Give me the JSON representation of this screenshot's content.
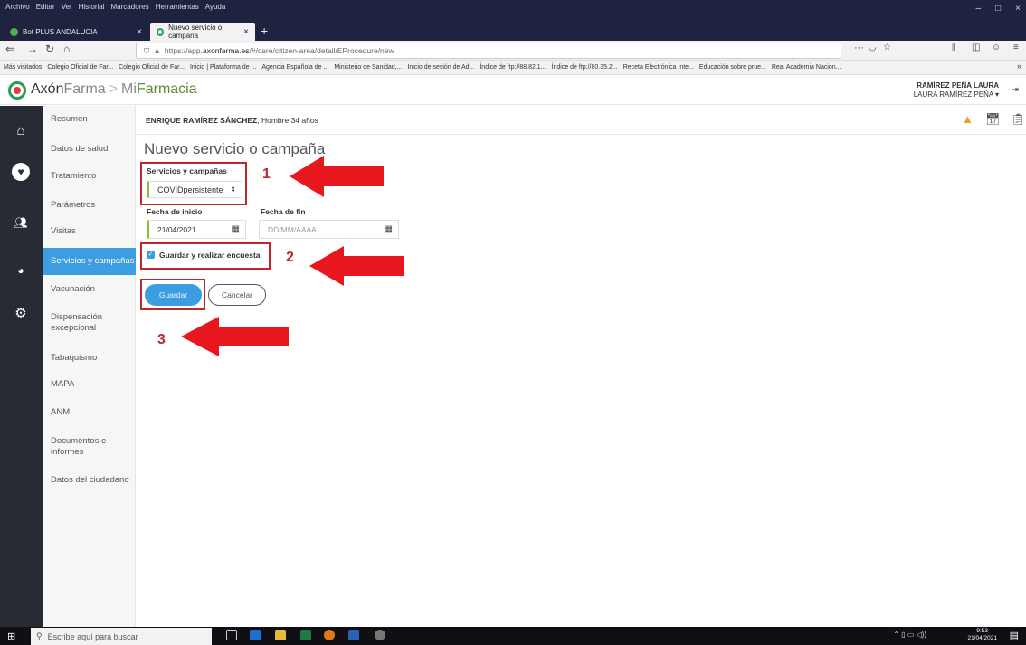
{
  "browser": {
    "menu": [
      "Archivo",
      "Editar",
      "Ver",
      "Historial",
      "Marcadores",
      "Herramientas",
      "Ayuda"
    ],
    "tabs": [
      {
        "label": "Bot PLUS ANDALUCIA",
        "close": "×"
      },
      {
        "label": "Nuevo servicio o campaña",
        "close": "×"
      }
    ],
    "new_tab": "+",
    "window_controls": {
      "minimize": "–",
      "maximize": "□",
      "close": "×"
    },
    "url": {
      "prefix": "https://app.",
      "domain": "axonfarma.es",
      "path": "/#/care/citizen-area/detail/EProcedure/new"
    },
    "url_more": "···",
    "bookmarks": [
      "Más visitados",
      "Colegio Oficial de Far...",
      "Colegio Oficial de Far...",
      "Inicio | Plataforma de ...",
      "Agencia Española de ...",
      "Ministerio de Sanidad,...",
      "Inicio de sesión de Ad...",
      "Índice de ftp://88.82.1...",
      "Índice de ftp://80.35.2...",
      "Receta Electrónica Inte...",
      "Educación sobre prue...",
      "Real Academia Nacion..."
    ],
    "bookmarks_more": "»"
  },
  "app": {
    "brand_axon": "Axón",
    "brand_farma": "Farma",
    "brand_sep": ">",
    "brand_mi": "Mi",
    "brand_farmacia": "Farmacia",
    "user_name": "RAMÍREZ PEÑA LAURA",
    "user_sub": "LAURA RAMÍREZ PEÑA ▾"
  },
  "sidebar": {
    "items": [
      "Resumen",
      "Datos de salud",
      "Tratamiento",
      "Parámetros",
      "Visitas",
      "Servicios y campañas",
      "Vacunación",
      "Dispensación excepcional",
      "Tabaquismo",
      "MAPA",
      "ANM",
      "Documentos e informes",
      "Datos del ciudadano"
    ],
    "active_index": 5
  },
  "patient": {
    "name": "ENRIQUE RAMÍREZ SÁNCHEZ",
    "info": ", Hombre 34 años"
  },
  "form": {
    "title": "Nuevo servicio o campaña",
    "service_label": "Servicios y campañas",
    "service_value": "COVIDpersistente",
    "start_label": "Fecha de inicio",
    "start_value": "21/04/2021",
    "end_label": "Fecha de fin",
    "end_placeholder": "DD/MM/AAAA",
    "checkbox_label": "Guardar y realizar encuesta",
    "checkbox_checked": true,
    "save_label": "Guardar",
    "cancel_label": "Cancelar"
  },
  "annotations": {
    "steps": [
      "1",
      "2",
      "3"
    ],
    "color": "#c0272d"
  },
  "taskbar": {
    "search_placeholder": "Escribe aquí para buscar",
    "time": "9:53",
    "date": "21/04/2021"
  },
  "colors": {
    "accent": "#3c9de0",
    "sidebar_dark": "#272b33",
    "brand_green": "#2b9b5b",
    "brand_red": "#e83a3a",
    "select_bar": "#8cc03c"
  }
}
